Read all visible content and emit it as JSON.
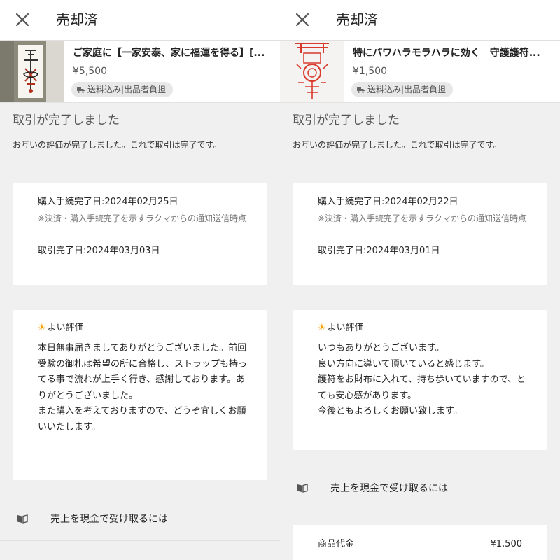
{
  "left": {
    "header": {
      "title": "売却済"
    },
    "product": {
      "title": "ご家庭に【一家安泰、家に福運を得る】[...",
      "price": "¥5,500",
      "shipping": "送料込み|出品者負担"
    },
    "status": {
      "heading": "取引が完了しました",
      "description": "お互いの評価が完了しました。これで取引は完了です。"
    },
    "dates": {
      "purchase": "購入手続完了日:2024年02月25日",
      "note": "※決済・購入手続完了を示すラクマからの通知送信時点",
      "complete": "取引完了日:2024年03月03日"
    },
    "evaluation": {
      "label": "よい評価",
      "text": "本日無事届きましてありがとうございました。前回受験の御札は希望の所に合格し、ストラップも持ってる事で流れが上手く行き、感謝しております。ありがとうございました。\nまた購入を考えておりますので、どうぞ宜しくお願いいたします。"
    },
    "cash_link": {
      "label": "売上を現金で受け取るには"
    }
  },
  "right": {
    "header": {
      "title": "売却済"
    },
    "product": {
      "title": "特にパワハラモラハラに効く　守護護符...",
      "price": "¥1,500",
      "shipping": "送料込み|出品者負担"
    },
    "status": {
      "heading": "取引が完了しました",
      "description": "お互いの評価が完了しました。これで取引は完了です。"
    },
    "dates": {
      "purchase": "購入手続完了日:2024年02月22日",
      "note": "※決済・購入手続完了を示すラクマからの通知送信時点",
      "complete": "取引完了日:2024年03月01日"
    },
    "evaluation": {
      "label": "よい評価",
      "text": "いつもありがとうございます。\n良い方向に導いて頂いていると感じます。\n護符をお財布に入れて、持ち歩いていますので、とても安心感があります。\n今後ともよろしくお願い致します。"
    },
    "cash_link": {
      "label": "売上を現金で受け取るには"
    },
    "price_row": {
      "label": "商品代金",
      "value": "¥1,500"
    }
  },
  "icons": {
    "close": "close-icon",
    "shipping": "truck-icon",
    "evaluation": "sun-icon",
    "cash": "book-icon"
  },
  "colors": {
    "accent_sun": "#f2a100",
    "background": "#f0f0f0",
    "card": "#ffffff"
  }
}
